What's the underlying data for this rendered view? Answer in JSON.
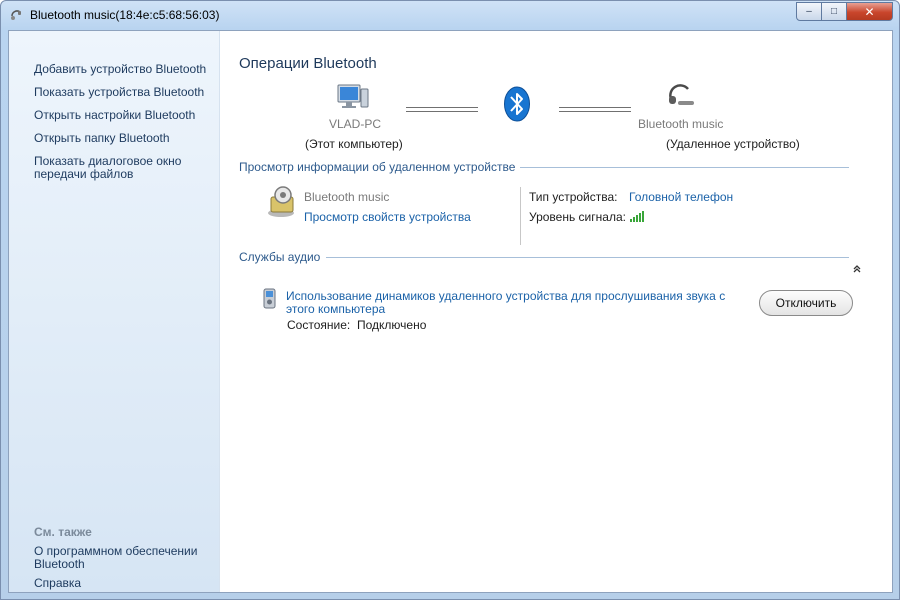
{
  "window": {
    "title": "Bluetooth music(18:4e:c5:68:56:03)",
    "caption": {
      "minimize": "–",
      "maximize": "□",
      "close": "✕"
    }
  },
  "sidebar": {
    "tasks": [
      "Добавить устройство Bluetooth",
      "Показать устройства Bluetooth",
      "Открыть настройки Bluetooth",
      "Открыть папку Bluetooth",
      "Показать диалоговое окно передачи файлов"
    ],
    "see_also_heading": "См. также",
    "see_also": [
      "О программном обеспечении Bluetooth",
      "Справка"
    ]
  },
  "main": {
    "heading": "Операции Bluetooth",
    "local": {
      "name": "VLAD-PC",
      "caption": "(Этот компьютер)"
    },
    "remote": {
      "name": "Bluetooth music",
      "caption": "(Удаленное устройство)"
    },
    "info_section": {
      "title": "Просмотр информации об удаленном устройстве",
      "device_name": "Bluetooth music",
      "properties_link": "Просмотр свойств устройства",
      "type_label": "Тип устройства:",
      "type_value": "Головной телефон",
      "signal_label": "Уровень сигнала:"
    },
    "audio_section": {
      "title": "Службы аудио",
      "service_link": "Использование динамиков удаленного устройства для прослушивания звука с этого компьютера",
      "status_label": "Состояние:",
      "status_value": "Подключено",
      "disconnect": "Отключить"
    }
  },
  "colors": {
    "link": "#1b62a8",
    "heading": "#1e395b",
    "bluetooth": "#1875d1",
    "signal": "#3aa63a"
  },
  "icons": {
    "title": "bluetooth-headset-icon",
    "computer": "computer-icon",
    "bluetooth": "bluetooth-logo-icon",
    "headset": "headset-icon",
    "device_info": "device-settings-icon",
    "signal": "signal-strength-icon",
    "audio_service": "audio-service-icon",
    "collapse": "collapse-chevron-icon"
  }
}
